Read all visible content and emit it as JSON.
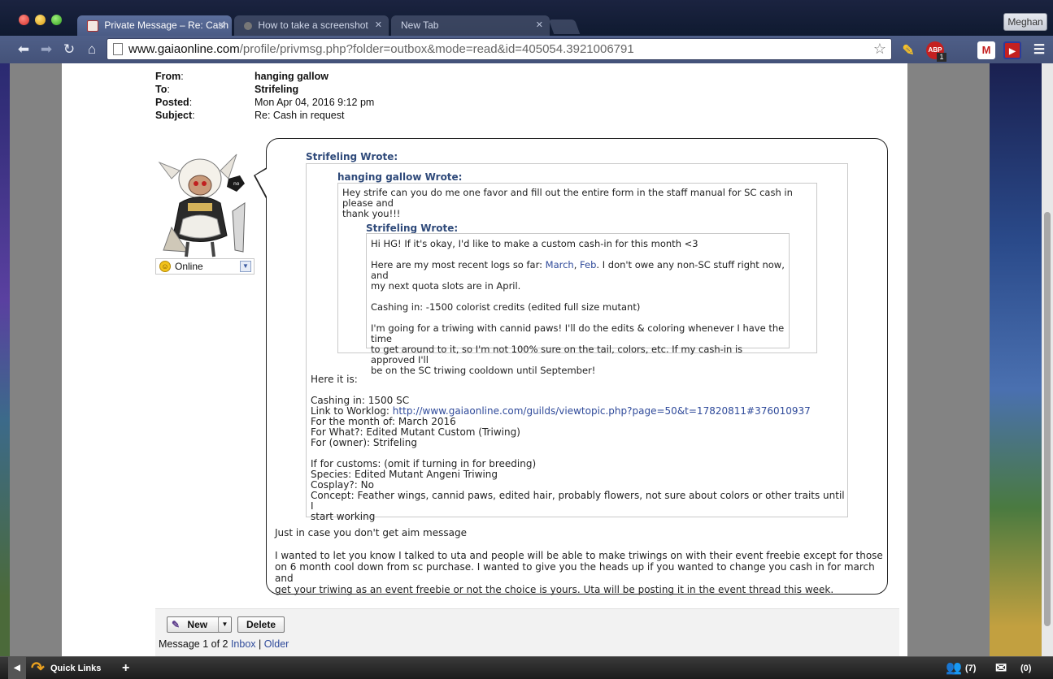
{
  "browser": {
    "tabs": [
      {
        "label": "Private Message – Re: Cash",
        "active": true
      },
      {
        "label": "How to take a screenshot",
        "active": false
      },
      {
        "label": "New Tab",
        "active": false
      }
    ],
    "profile_name": "Meghan",
    "url_host": "www.gaiaonline.com",
    "url_path": "/profile/privmsg.php?folder=outbox&mode=read&id=405054.3921006791",
    "abp_badge": "1",
    "abp_label": "ABP"
  },
  "message": {
    "labels": {
      "from": "From",
      "to": "To",
      "posted": "Posted",
      "subject": "Subject"
    },
    "from": "hanging gallow",
    "to": "Strifeling",
    "posted": "Mon Apr 04, 2016 9:12 pm",
    "subject": "Re: Cash in request",
    "status": "Online",
    "quote_outer_header": "Strifeling Wrote:",
    "quote_mid_header": "hanging gallow Wrote:",
    "quote_mid_text_1": "Hey strife can you do me one favor and fill out the entire form in the staff manual for SC cash in please and",
    "quote_mid_text_2": "thank you!!!",
    "quote_inner_header": "Strifeling Wrote:",
    "quote_inner": {
      "line1": "Hi HG! If it's okay, I'd like to make a custom cash-in for this month <3",
      "logs_prefix": "Here are my most recent logs so far: ",
      "logs_link1": "March",
      "logs_sep": ", ",
      "logs_link2": "Feb",
      "logs_suffix": ". I don't owe any non-SC stuff right now, and",
      "logs_line2": "my next quota slots are in April.",
      "cashing": "Cashing in: -1500 colorist credits (edited full size mutant)",
      "plan1": "I'm going for a triwing with cannid paws! I'll do the edits & coloring whenever I have the time",
      "plan2": "to get around to it, so I'm not 100% sure on the tail, colors, etc. If my cash-in is approved I'll",
      "plan3": "be on the SC triwing cooldown until September!"
    },
    "form": {
      "intro": "Here it is:",
      "cashing": "Cashing in: 1500 SC",
      "worklog_label": "Link to Worklog: ",
      "worklog_link": "http://www.gaiaonline.com/guilds/viewtopic.php?page=50&t=17820811#376010937",
      "month": "For the month of: March 2016",
      "what": "For What?: Edited Mutant Custom (Triwing)",
      "owner": "For (owner): Strifeling",
      "customs": "If for customs: (omit if turning in for breeding)",
      "species": "Species: Edited Mutant Angeni Triwing",
      "cosplay": "Cosplay?: No",
      "concept1": "Concept: Feather wings, cannid paws, edited hair, probably flowers, not sure about colors or other traits until I",
      "concept2": "start working"
    },
    "reply_1": "Just in case you don't get aim message",
    "reply_2a": "I wanted to let you know I talked to uta and people will be able to make triwings on with their event freebie except for those",
    "reply_2b": "on 6 month cool down from sc purchase. I wanted to give you the heads up if you wanted to change you cash in for march and",
    "reply_2c": "get your triwing as an event freebie or not the choice is yours. Uta will be posting it in the event thread this week."
  },
  "actions": {
    "new_label": "New",
    "delete_label": "Delete",
    "nav_prefix": "Message 1 of 2",
    "inbox": "Inbox",
    "sep": "|",
    "older": "Older"
  },
  "dock": {
    "quick_links": "Quick Links",
    "add": "+",
    "friends_count": "(7)",
    "mail_count": "(0)"
  }
}
